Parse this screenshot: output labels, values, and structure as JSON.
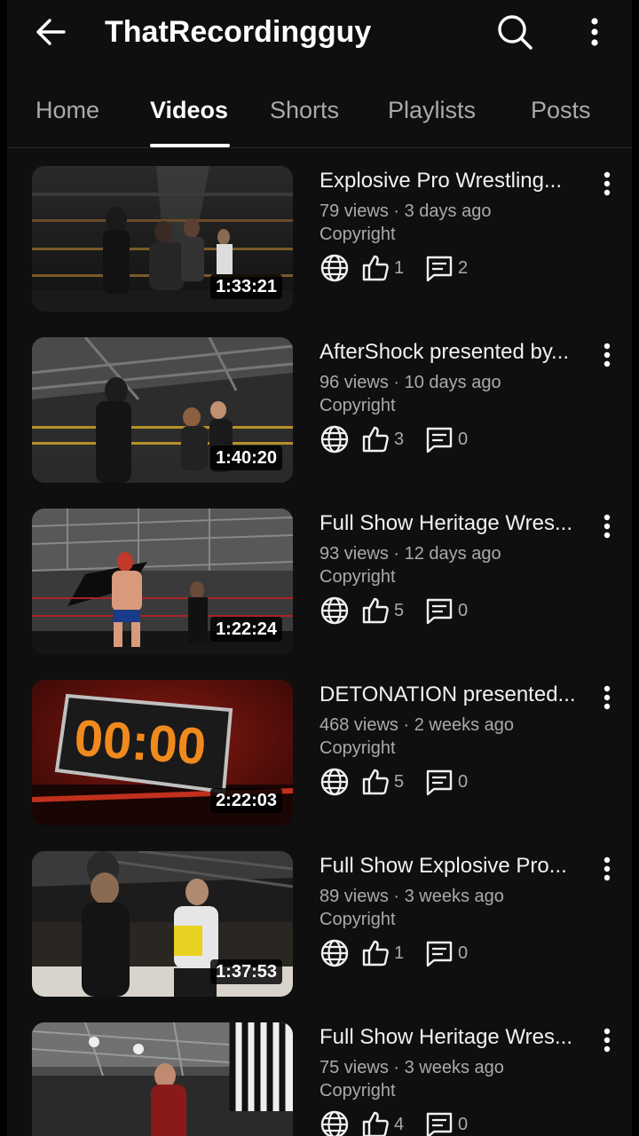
{
  "header": {
    "channel_name": "ThatRecordingguy"
  },
  "tabs": [
    {
      "label": "Home"
    },
    {
      "label": "Videos",
      "active": true
    },
    {
      "label": "Shorts"
    },
    {
      "label": "Playlists"
    },
    {
      "label": "Posts"
    }
  ],
  "videos": [
    {
      "title": "Explosive Pro Wrestling...",
      "views": "79 views",
      "age": "3 days ago",
      "license": "Copyright",
      "visibility_icon": "globe-icon",
      "likes": "1",
      "comments": "2",
      "duration": "1:33:21",
      "thumb": "dark wrestling ring scene"
    },
    {
      "title": "AfterShock presented by...",
      "views": "96 views",
      "age": "10 days ago",
      "license": "Copyright",
      "visibility_icon": "globe-icon",
      "likes": "3",
      "comments": "0",
      "duration": "1:40:20",
      "thumb": "wrestlers in ring under lights"
    },
    {
      "title": "Full Show Heritage Wres...",
      "views": "93 views",
      "age": "12 days ago",
      "license": "Copyright",
      "visibility_icon": "globe-icon",
      "likes": "5",
      "comments": "0",
      "duration": "1:22:24",
      "thumb": "wrestler in ring with referee"
    },
    {
      "title": "DETONATION presented...",
      "views": "468 views",
      "age": "2 weeks ago",
      "license": "Copyright",
      "visibility_icon": "globe-icon",
      "likes": "5",
      "comments": "0",
      "duration": "2:22:03",
      "thumb": "countdown screen",
      "screen_text": "00:00"
    },
    {
      "title": "Full Show Explosive Pro...",
      "views": "89 views",
      "age": "3 weeks ago",
      "license": "Copyright",
      "visibility_icon": "globe-icon",
      "likes": "1",
      "comments": "0",
      "duration": "1:37:53",
      "thumb": "promo with microphone"
    },
    {
      "title": "Full Show Heritage Wres...",
      "views": "75 views",
      "age": "3 weeks ago",
      "license": "Copyright",
      "visibility_icon": "globe-icon",
      "likes": "4",
      "comments": "0",
      "duration": "",
      "thumb": "wrestlers with referee"
    }
  ],
  "colors": {
    "background": "#0f0f0f",
    "text_primary": "#f1f1f1",
    "text_secondary": "#aaaaaa",
    "countdown": "#f08a1e"
  }
}
